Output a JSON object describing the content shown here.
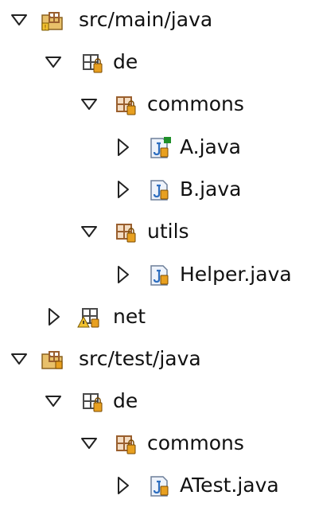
{
  "tree": {
    "nodes": [
      {
        "label": "src/main/java",
        "type": "source-folder",
        "expanded": true,
        "level": 0
      },
      {
        "label": "de",
        "type": "package",
        "expanded": true,
        "level": 1
      },
      {
        "label": "commons",
        "type": "package",
        "expanded": true,
        "level": 2
      },
      {
        "label": "A.java",
        "type": "java-file-modified",
        "expanded": false,
        "level": 3
      },
      {
        "label": "B.java",
        "type": "java-file",
        "expanded": false,
        "level": 3
      },
      {
        "label": "utils",
        "type": "package",
        "expanded": true,
        "level": 2
      },
      {
        "label": "Helper.java",
        "type": "java-file",
        "expanded": false,
        "level": 3
      },
      {
        "label": "net",
        "type": "package-warning",
        "expanded": false,
        "level": 1
      },
      {
        "label": "src/test/java",
        "type": "source-folder",
        "expanded": true,
        "level": 0
      },
      {
        "label": "de",
        "type": "package",
        "expanded": true,
        "level": 1
      },
      {
        "label": "commons",
        "type": "package",
        "expanded": true,
        "level": 2
      },
      {
        "label": "ATest.java",
        "type": "java-file",
        "expanded": false,
        "level": 3
      }
    ]
  },
  "colors": {
    "folder_fill": "#e8c06a",
    "package_brown": "#9a5f2e",
    "package_dark": "#4a4a4a",
    "java_file_fill": "#eef3fb",
    "java_file_border": "#6d7f99",
    "java_j": "#2f6fc0",
    "lock_orange": "#e8a020",
    "warning_yellow": "#f2c230",
    "modified_green": "#1f8f2a",
    "text": "#111111"
  }
}
